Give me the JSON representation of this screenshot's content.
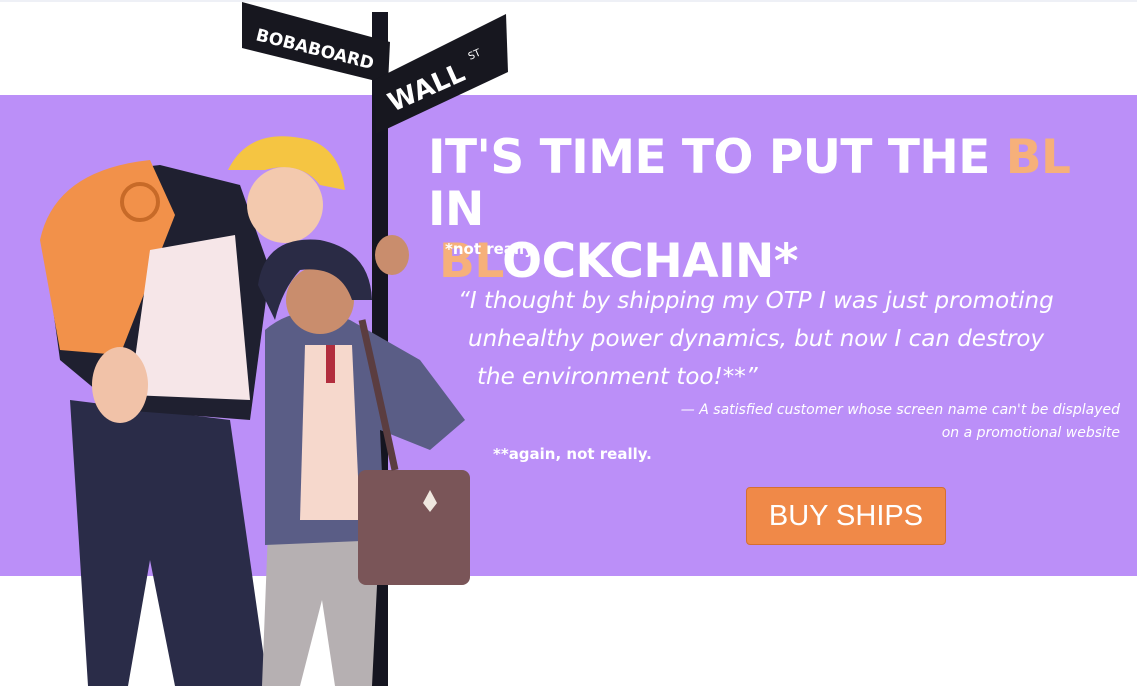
{
  "signs": {
    "left": "BOBABOARD",
    "right": "WALL",
    "right_sup": "ST"
  },
  "hero": {
    "headline": {
      "part1": "IT'S TIME TO PUT THE ",
      "hl1": "BL",
      "part2": " IN",
      "hl2": "BL",
      "part3": "OCKCHAIN*"
    },
    "footnote1": "*not really",
    "quote": {
      "line1": "“I thought by shipping my OTP I was just promoting",
      "line2": "unhealthy power dynamics, but now I can destroy",
      "line3": "the environment too!**”"
    },
    "attribution": {
      "line1": "— A satisfied customer whose screen name can't be displayed",
      "line2": "on a promotional website"
    },
    "footnote2": "**again, not really.",
    "cta_label": "BUY SHIPS"
  },
  "colors": {
    "band": "#bb8ff8",
    "highlight": "#f6b07a",
    "button": "#f08948"
  }
}
